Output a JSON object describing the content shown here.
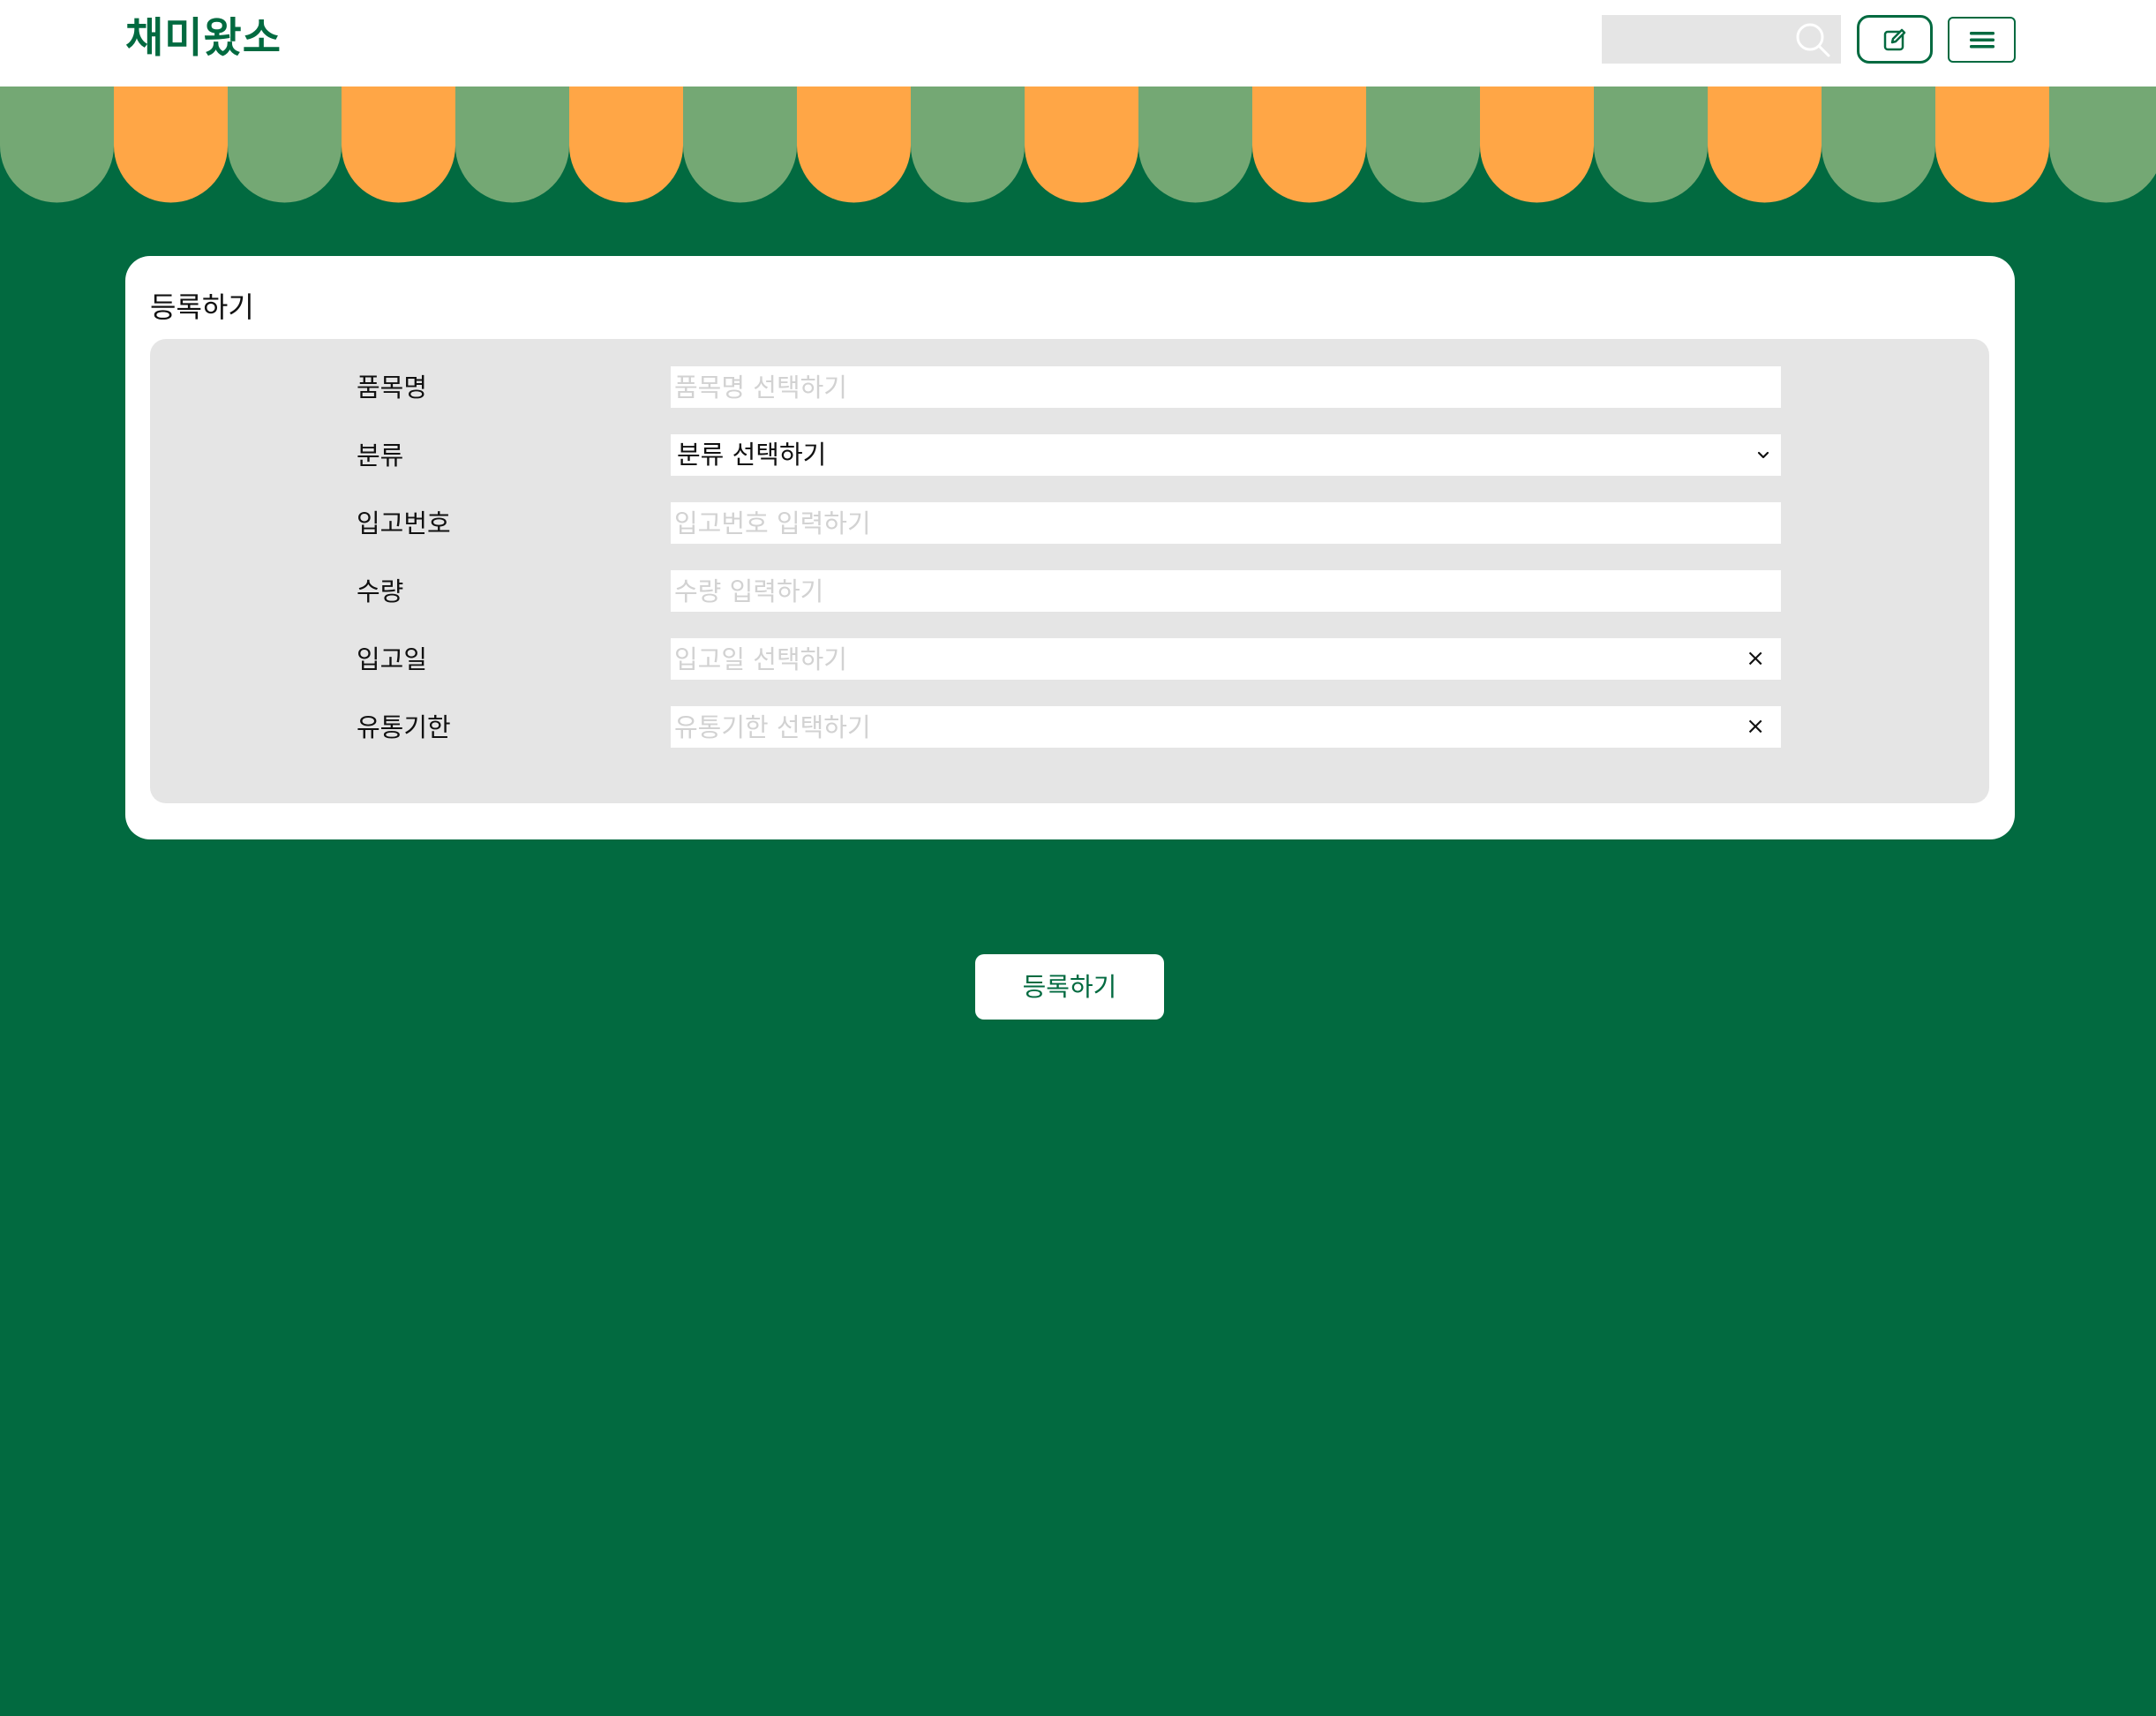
{
  "header": {
    "logo": "채미왔소",
    "search": {
      "value": "",
      "placeholder": ""
    },
    "icons": {
      "search": "search-icon",
      "write": "edit-icon",
      "menu": "hamburger-menu-icon"
    }
  },
  "colors": {
    "brand_green": "#026a40",
    "awning_orange": "#ffa646",
    "awning_green": "#74a874",
    "panel_gray": "#e5e5e5"
  },
  "card": {
    "title": "등록하기"
  },
  "form": {
    "fields": [
      {
        "label": "품목명",
        "type": "input",
        "value": "",
        "placeholder": "품목명 선택하기"
      },
      {
        "label": "분류",
        "type": "select",
        "value": "분류 선택하기"
      },
      {
        "label": "입고번호",
        "type": "input",
        "value": "",
        "placeholder": "입고번호 입력하기"
      },
      {
        "label": "수량",
        "type": "input",
        "value": "",
        "placeholder": "수량 입력하기"
      },
      {
        "label": "입고일",
        "type": "date",
        "value": "",
        "placeholder": "입고일 선택하기",
        "clear": "×"
      },
      {
        "label": "유통기한",
        "type": "date",
        "value": "",
        "placeholder": "유통기한 선택하기",
        "clear": "×"
      }
    ]
  },
  "submit": {
    "label": "등록하기"
  }
}
